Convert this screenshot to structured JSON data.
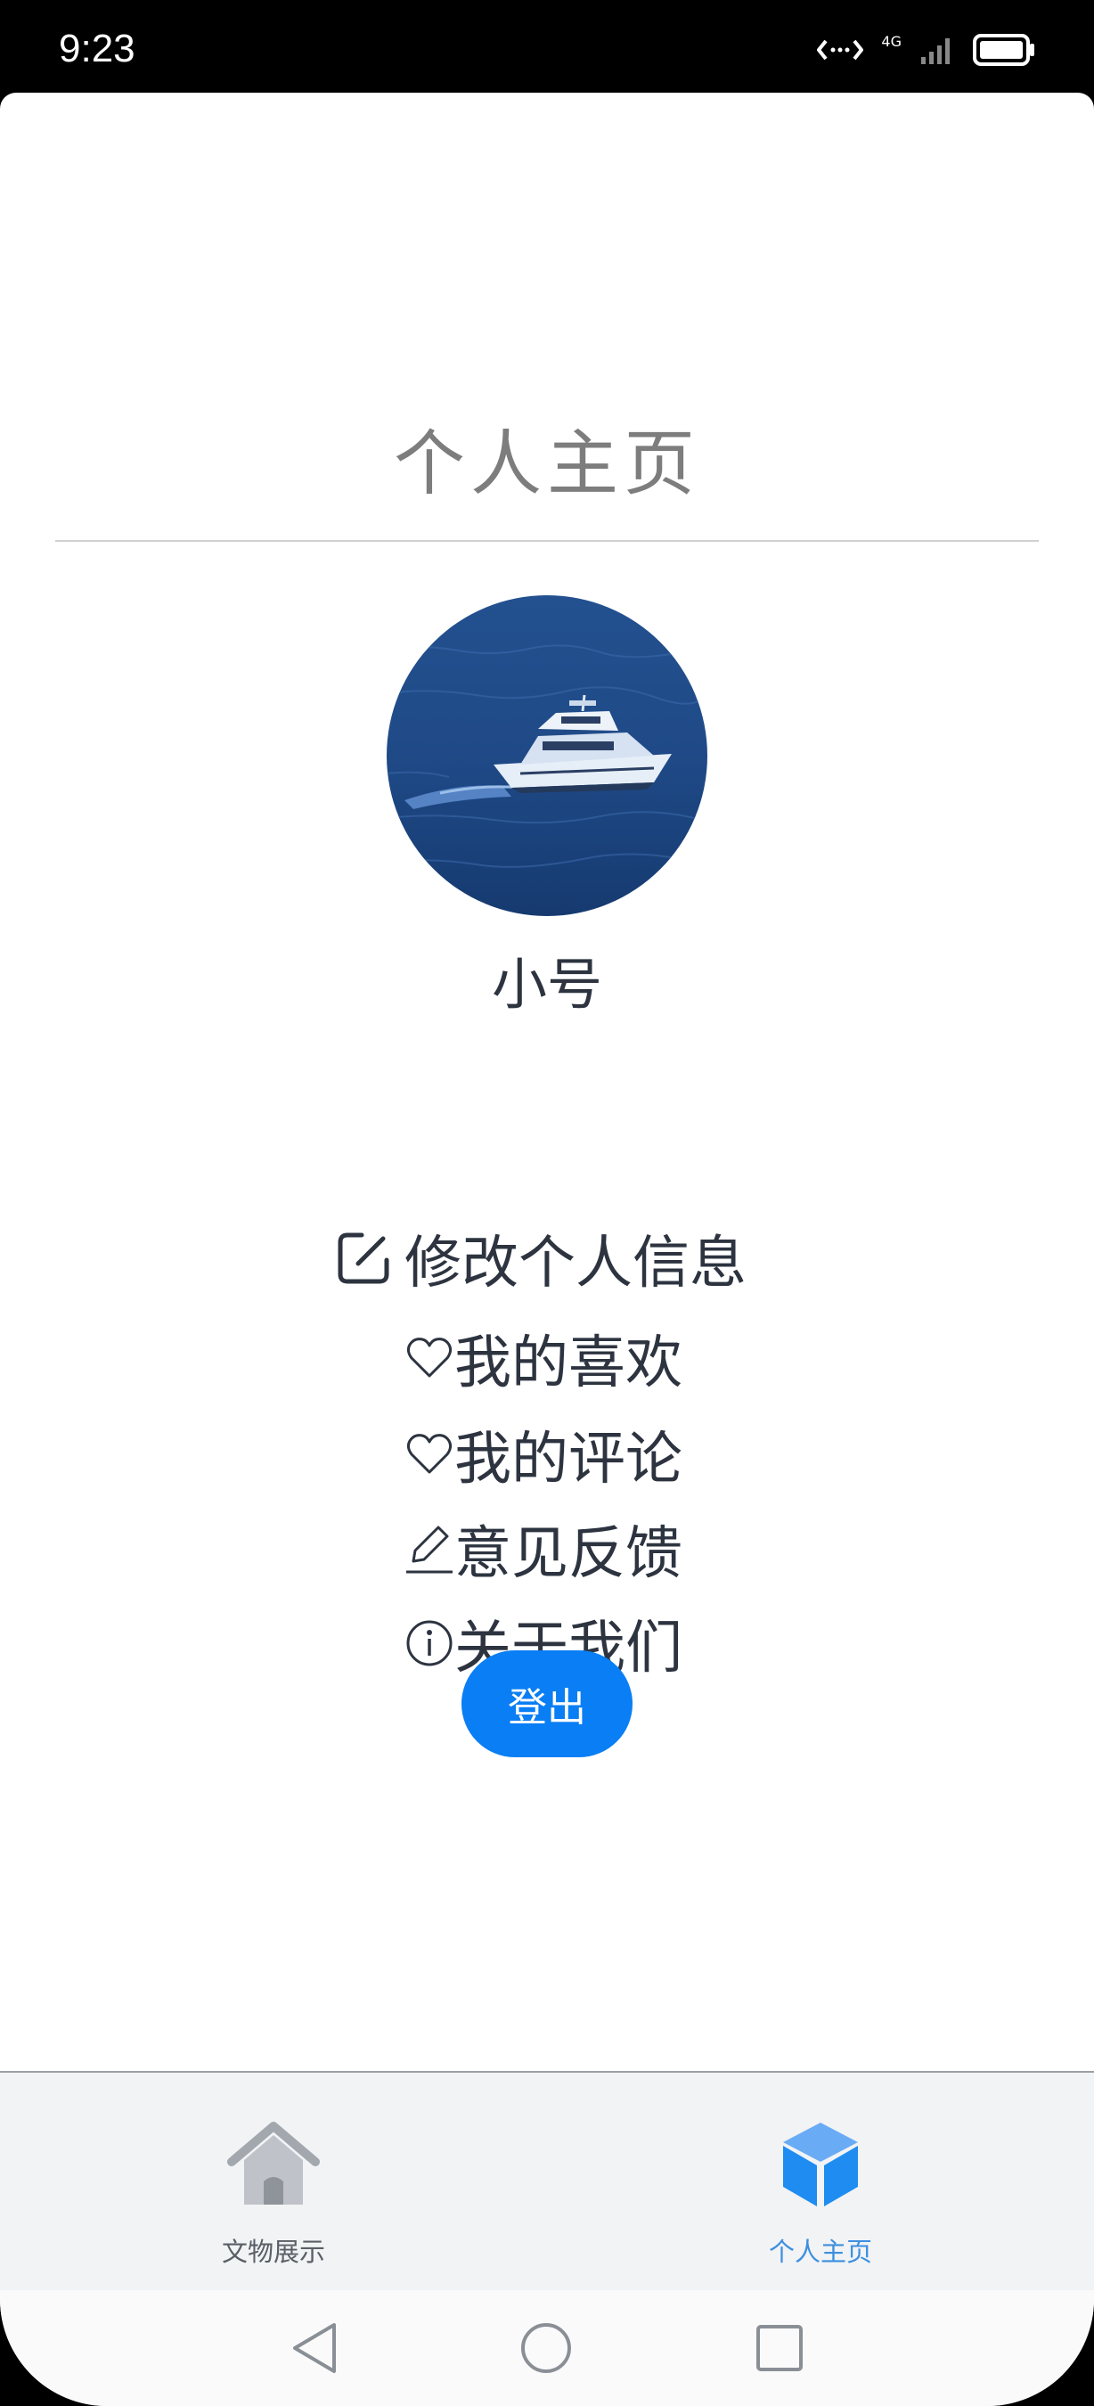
{
  "status_bar": {
    "time": "9:23",
    "network": "4G"
  },
  "page": {
    "title": "个人主页",
    "username": "小号"
  },
  "menu": {
    "items": [
      {
        "label": "修改个人信息",
        "icon": "edit-square-icon"
      },
      {
        "label": "我的喜欢",
        "icon": "heart-icon"
      },
      {
        "label": "我的评论",
        "icon": "heart-icon"
      },
      {
        "label": "意见反馈",
        "icon": "pen-icon"
      },
      {
        "label": "关于我们",
        "icon": "info-icon"
      }
    ]
  },
  "logout": {
    "label": "登出"
  },
  "tabs": [
    {
      "label": "文物展示",
      "icon": "home-icon",
      "active": false
    },
    {
      "label": "个人主页",
      "icon": "cube-icon",
      "active": true
    }
  ],
  "colors": {
    "accent": "#0a7ef4",
    "active_tab": "#1e8cf0",
    "inactive_tab": "#8a8f96",
    "text": "#2d3440",
    "title": "#7d7d7d"
  },
  "nav": {
    "buttons": [
      "back-icon",
      "home-circle-icon",
      "recents-icon"
    ]
  }
}
